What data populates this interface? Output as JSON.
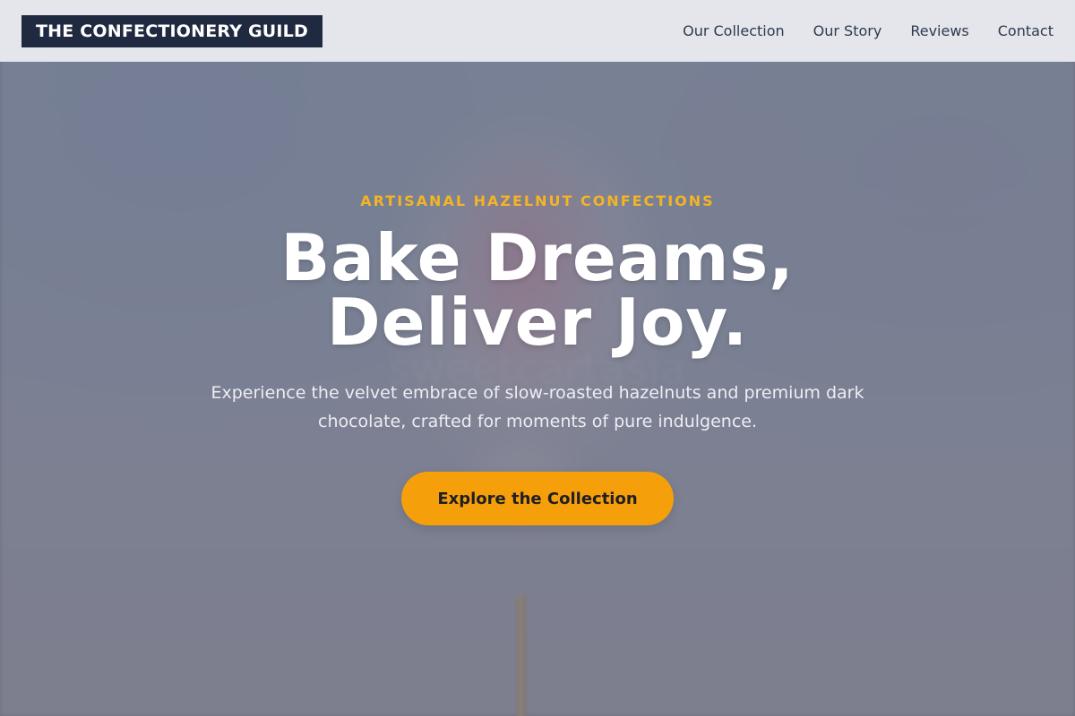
{
  "header": {
    "brand": "THE CONFECTIONERY GUILD",
    "nav": [
      {
        "label": "Our Collection"
      },
      {
        "label": "Our Story"
      },
      {
        "label": "Reviews"
      },
      {
        "label": "Contact"
      }
    ]
  },
  "hero": {
    "eyebrow": "ARTISANAL HAZELNUT CONFECTIONS",
    "title_line1": "Bake Dreams,",
    "title_line2": "Deliver Joy.",
    "subtitle": "Experience the velvet embrace of slow-roasted hazelnuts and premium dark chocolate, crafted for moments of pure indulgence.",
    "cta_label": "Explore the Collection",
    "background_watermark": "sweetcartasia"
  },
  "colors": {
    "brand_bg": "#1f2a40",
    "accent": "#f59f0b",
    "eyebrow": "#f3b425",
    "header_bg": "#e8eaee"
  }
}
